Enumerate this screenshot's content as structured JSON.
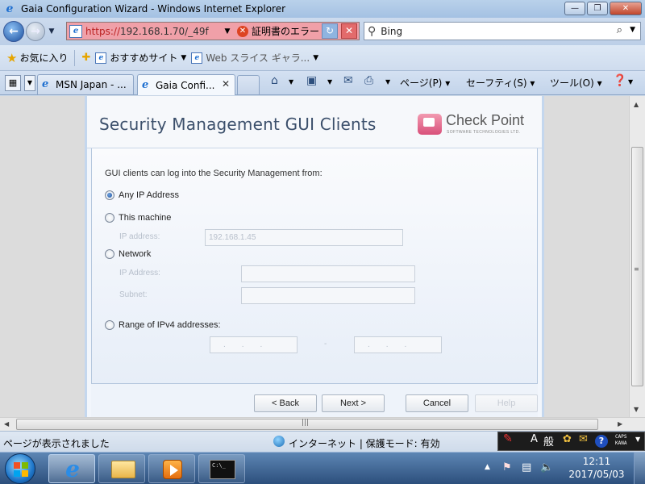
{
  "window": {
    "title": "Gaia Configuration Wizard - Windows Internet Explorer",
    "minimize": "—",
    "restore": "❐",
    "close": "✕"
  },
  "address_bar": {
    "scheme": "https://",
    "host": "192.168.1.70",
    "path": "/_49f",
    "cert_error": "証明書のエラー",
    "refresh": "↻",
    "stop": "✕"
  },
  "search": {
    "provider": "Bing",
    "go_icon": "⌕"
  },
  "favorites": {
    "label": "お気に入り",
    "items": [
      "おすすめサイト",
      "Web スライス ギャラ..."
    ]
  },
  "tabs": [
    {
      "label": "MSN Japan - ..."
    },
    {
      "label": "Gaia Confi..."
    }
  ],
  "command_bar": {
    "page": "ページ(P)",
    "safety": "セーフティ(S)",
    "tools": "ツール(O)"
  },
  "wizard": {
    "title": "Security Management GUI Clients",
    "logo_text": "Check Point",
    "logo_sub": "SOFTWARE TECHNOLOGIES LTD.",
    "intro": "GUI clients can log into the Security Management from:",
    "options": {
      "any": "Any IP Address",
      "this_machine": "This machine",
      "network": "Network",
      "range": "Range of IPv4 addresses:"
    },
    "selected": "any",
    "this_machine_ip_label": "IP address:",
    "this_machine_ip_value": "192.168.1.45",
    "network_ip_label": "IP Address:",
    "network_subnet_label": "Subnet:",
    "range_dash": "-",
    "buttons": {
      "back": "< Back",
      "next": "Next >",
      "cancel": "Cancel",
      "help": "Help"
    }
  },
  "status": {
    "text": "ページが表示されました",
    "zone": "インターネット | 保護モード: 有効"
  },
  "ime": {
    "mode": "A",
    "kanji": "般",
    "caps": "CAPS",
    "kana": "KANA"
  },
  "clock": {
    "time": "12:11",
    "date": "2017/05/03"
  }
}
